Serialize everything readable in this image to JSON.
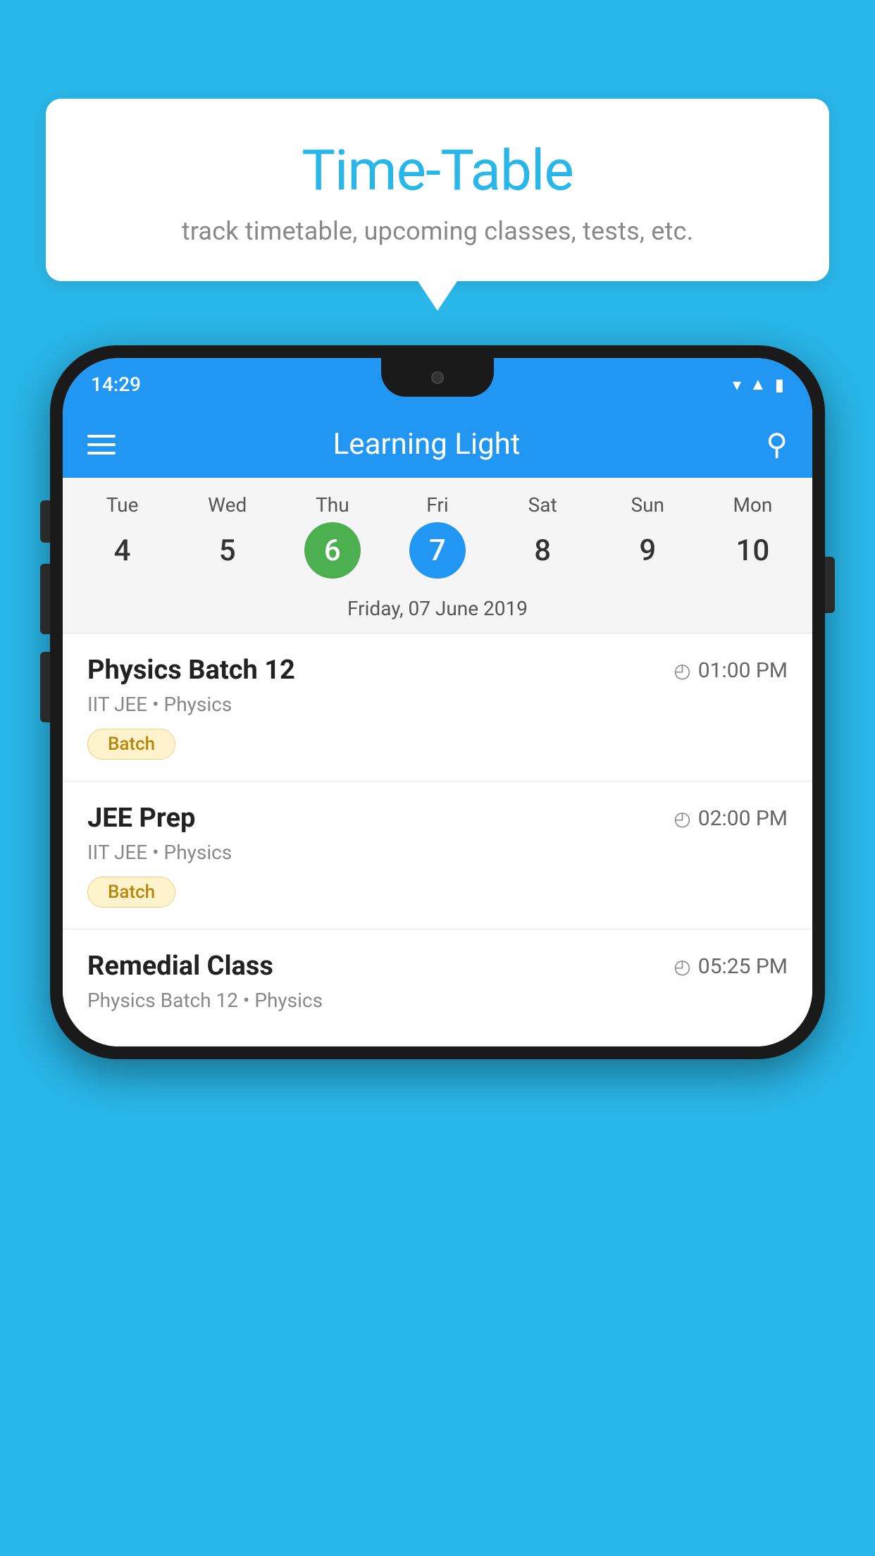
{
  "background_color": "#29b6e8",
  "bubble": {
    "title": "Time-Table",
    "subtitle": "track timetable, upcoming classes, tests, etc."
  },
  "phone": {
    "status_bar": {
      "time": "14:29"
    },
    "app_header": {
      "title": "Learning Light"
    },
    "calendar": {
      "days": [
        "Tue",
        "Wed",
        "Thu",
        "Fri",
        "Sat",
        "Sun",
        "Mon"
      ],
      "dates": [
        "4",
        "5",
        "6",
        "7",
        "8",
        "9",
        "10"
      ],
      "today_index": 2,
      "selected_index": 3,
      "selected_date_label": "Friday, 07 June 2019"
    },
    "schedule": [
      {
        "title": "Physics Batch 12",
        "time": "01:00 PM",
        "subtitle": "IIT JEE • Physics",
        "badge": "Batch"
      },
      {
        "title": "JEE Prep",
        "time": "02:00 PM",
        "subtitle": "IIT JEE • Physics",
        "badge": "Batch"
      },
      {
        "title": "Remedial Class",
        "time": "05:25 PM",
        "subtitle": "Physics Batch 12 • Physics",
        "badge": null
      }
    ]
  }
}
